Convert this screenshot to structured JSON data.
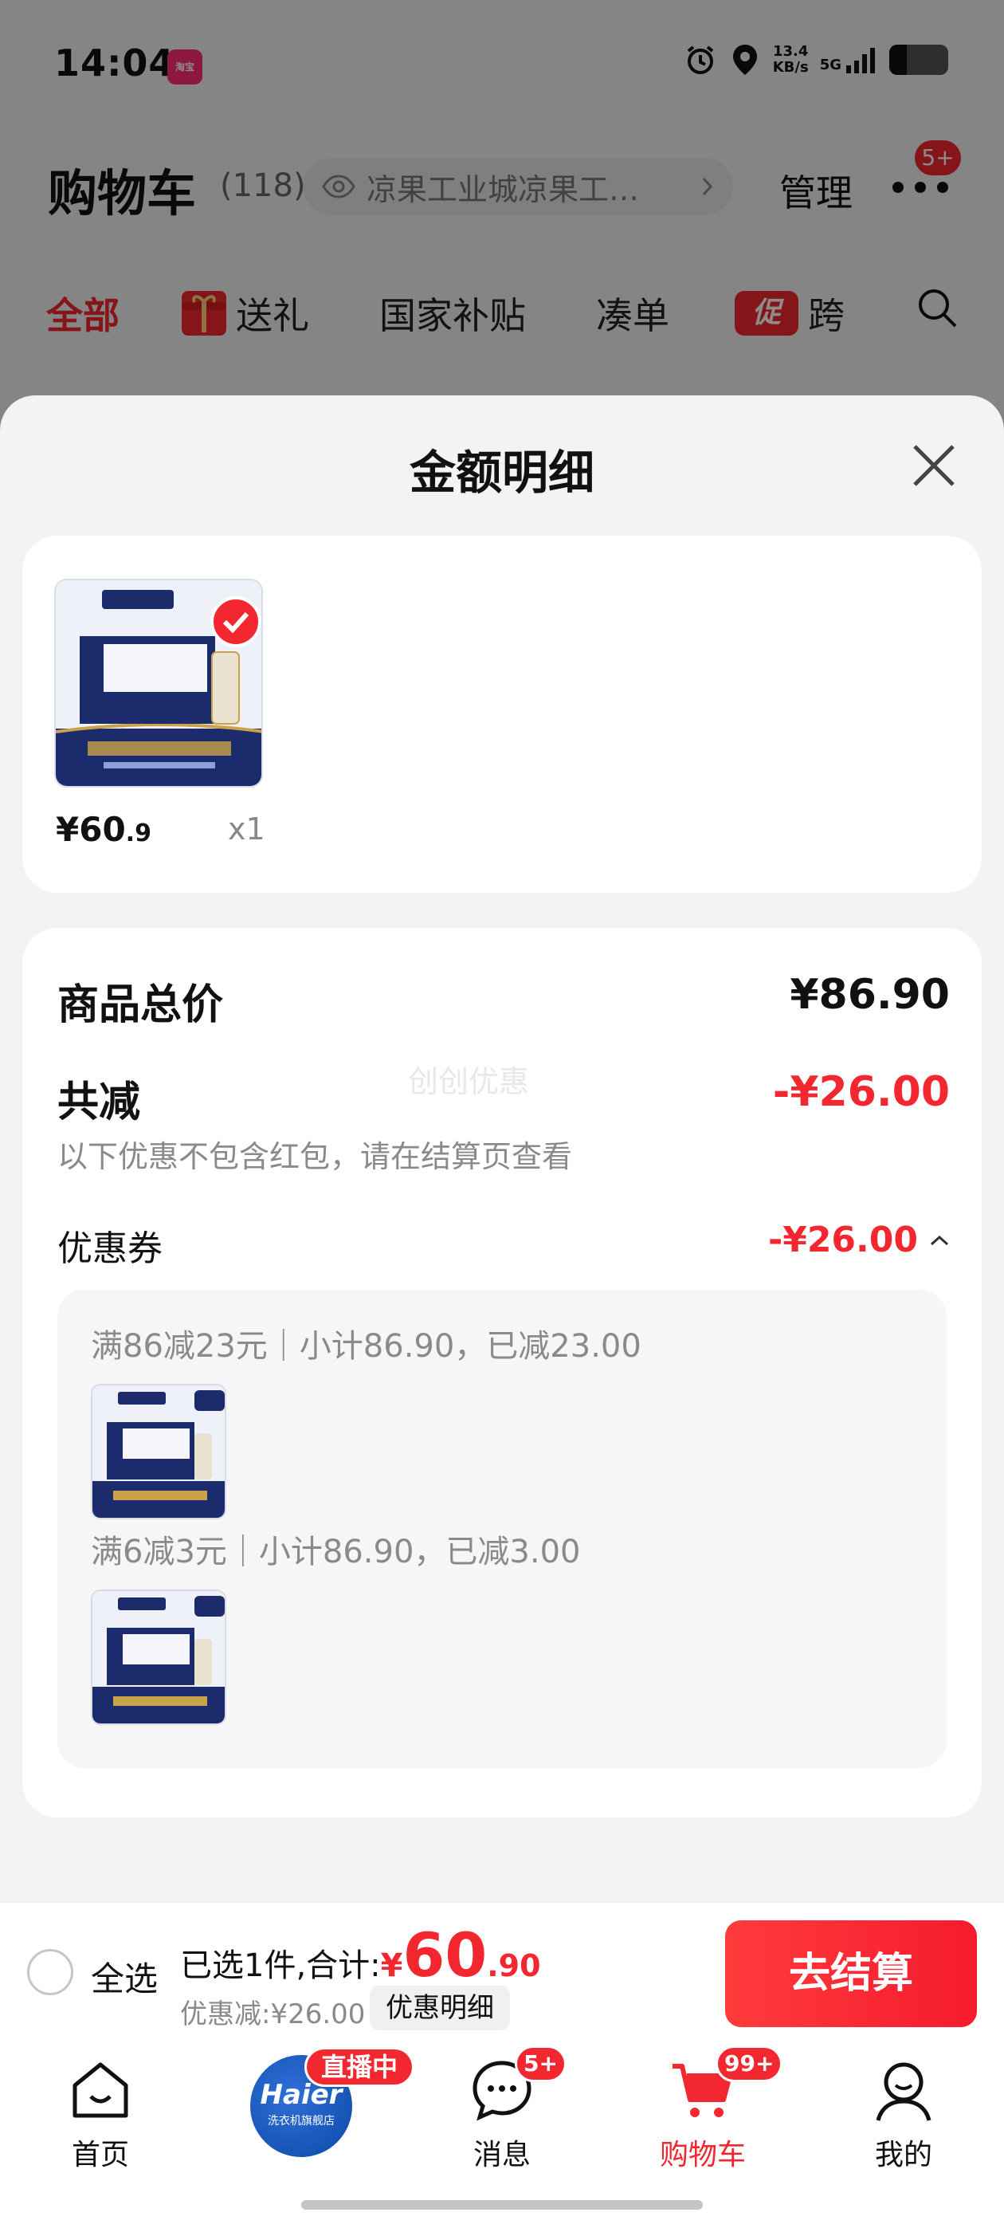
{
  "status_bar": {
    "time": "14:04",
    "app_badge": "淘宝",
    "net_speed": "13.4",
    "net_speed_unit": "KB/s",
    "net_type": "5G",
    "battery_level": 0.3
  },
  "cart_header": {
    "title": "购物车",
    "count": "(118)",
    "address": "凉果工业城凉果工…",
    "manage_label": "管理",
    "more_badge": "5+"
  },
  "filter_tabs": [
    {
      "label": "全部",
      "active": true
    },
    {
      "label": "送礼",
      "active": false
    },
    {
      "label": "国家补贴",
      "active": false
    },
    {
      "label": "凑单",
      "active": false
    },
    {
      "label": "跨",
      "icon_text": "促",
      "active": false
    }
  ],
  "sheet": {
    "title": "金额明细",
    "product": {
      "price_int": "¥60",
      "price_dec": ".9",
      "qty": "x1"
    },
    "total_price_label": "商品总价",
    "total_price_value": "¥86.90",
    "discount_label": "共减",
    "discount_value": "-¥26.00",
    "discount_note": "以下优惠不包含红包，请在结算页查看",
    "watermark": "创创优惠",
    "coupon_label": "优惠券",
    "coupon_value": "-¥26.00",
    "coupon_rules": [
      "满86减23元｜小计86.90，已减23.00",
      "满6减3元｜小计86.90，已减3.00"
    ]
  },
  "checkout": {
    "select_all_label": "全选",
    "selected_text": "已选1件,合计:",
    "total_currency": "¥",
    "total_int": "60",
    "total_dec": ".90",
    "discount_text": "优惠减:¥26.00",
    "detail_button": "优惠明细",
    "checkout_button": "去结算"
  },
  "bottom_nav": {
    "home": "首页",
    "live_store_name": "Haier",
    "live_store_sub": "洗衣机旗舰店",
    "live_badge": "直播中",
    "messages": "消息",
    "messages_badge": "5+",
    "cart": "购物车",
    "cart_badge": "99+",
    "mine": "我的"
  },
  "colors": {
    "accent": "#f2272f",
    "checkout_gradient_start": "#ff3b3b",
    "muted_text": "#8a8a8a",
    "product_navy": "#1b2b6b",
    "product_gold": "#c9a24a"
  }
}
